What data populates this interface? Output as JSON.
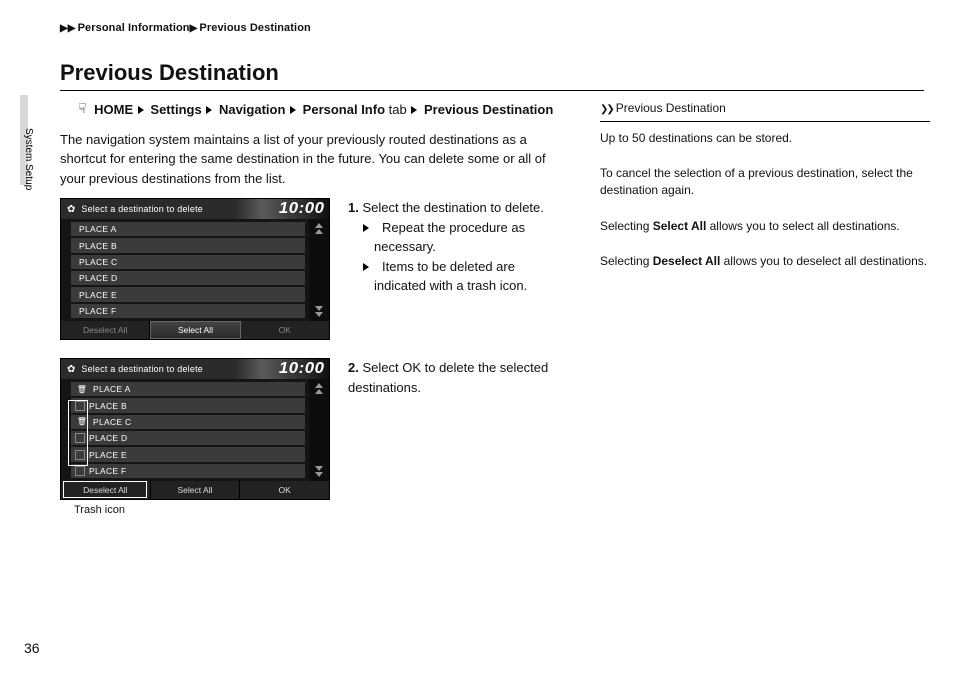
{
  "breadcrumb": {
    "seg1": "Personal Information",
    "seg2": "Previous Destination"
  },
  "title": "Previous Destination",
  "sideTab": "System Setup",
  "pageNumber": "36",
  "navPath": {
    "home": "HOME",
    "settings": "Settings",
    "navigation": "Navigation",
    "personalInfo": "Personal Info",
    "tabWord": "tab",
    "previousDestination": "Previous Destination"
  },
  "intro": "The navigation system maintains a list of your previously routed destinations as a shortcut for entering the same destination in the future. You can delete some or all of your previous destinations from the list.",
  "screenshot": {
    "headerTitle": "Select a destination to delete",
    "clock": "10:00",
    "items": [
      "PLACE A",
      "PLACE B",
      "PLACE C",
      "PLACE D",
      "PLACE E",
      "PLACE F"
    ],
    "footer": {
      "deselect": "Deselect All",
      "select": "Select All",
      "ok": "OK"
    }
  },
  "shot2Caption": "Trash icon",
  "step1": {
    "num": "1.",
    "text": "Select the destination to delete.",
    "sub1": "Repeat the procedure as necessary.",
    "sub2": "Items to be deleted are indicated with a trash icon."
  },
  "step2": {
    "num": "2.",
    "textA": "Select ",
    "ok": "OK",
    "textB": " to delete the selected destinations."
  },
  "sidebar": {
    "heading": "Previous Destination",
    "p1": "Up to 50 destinations can be stored.",
    "p2": "To cancel the selection of a previous destination, select the destination again.",
    "p3a": "Selecting ",
    "p3b": "Select All",
    "p3c": " allows you to select all destinations.",
    "p4a": "Selecting ",
    "p4b": "Deselect All",
    "p4c": " allows you to deselect all destinations."
  }
}
